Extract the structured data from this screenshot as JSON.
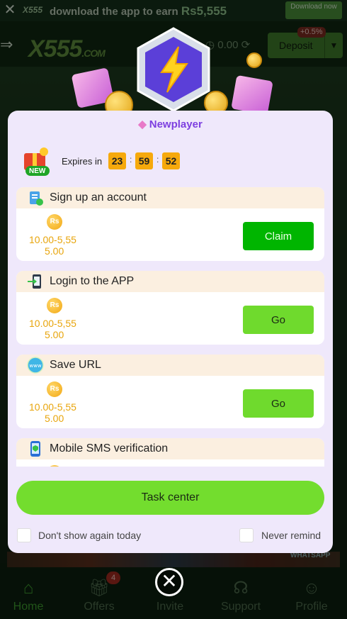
{
  "topbar": {
    "close_glyph": "✕",
    "logo": "X555",
    "promo_text": "download the app to earn",
    "promo_amount": "Rs5,555",
    "download_button": "Download now"
  },
  "header": {
    "logo_main": "X555",
    "logo_suffix": ".COM",
    "balance": "0.00",
    "deposit_label": "Deposit",
    "bonus_badge": "+0.5%"
  },
  "modal": {
    "title": "Newplayer",
    "new_tag": "NEW",
    "expires_label": "Expires in",
    "timer": {
      "hours": "23",
      "minutes": "59",
      "seconds": "52",
      "separator": ":"
    },
    "tasks": [
      {
        "title": "Sign up an account",
        "currency": "Rs",
        "amount_line1": "10.00-5,55",
        "amount_line2": "5.00",
        "button": "Claim",
        "icon": "clipboard-check-icon"
      },
      {
        "title": "Login to the APP",
        "currency": "Rs",
        "amount_line1": "10.00-5,55",
        "amount_line2": "5.00",
        "button": "Go",
        "icon": "phone-login-icon"
      },
      {
        "title": "Save URL",
        "currency": "Rs",
        "amount_line1": "10.00-5,55",
        "amount_line2": "5.00",
        "button": "Go",
        "icon": "www-globe-icon"
      },
      {
        "title": "Mobile SMS verification",
        "currency": "Rs",
        "icon": "mobile-shield-icon"
      }
    ],
    "task_center_button": "Task center",
    "dont_show_label": "Don't show again today",
    "never_remind_label": "Never remind"
  },
  "bottom_nav": {
    "items": [
      {
        "label": "Home",
        "icon": "home-icon"
      },
      {
        "label": "Offers",
        "icon": "gift-icon",
        "badge": "4"
      },
      {
        "label": "Invite",
        "icon": "invite-icon"
      },
      {
        "label": "Support",
        "icon": "headset-icon"
      },
      {
        "label": "Profile",
        "icon": "user-icon"
      }
    ]
  },
  "background_tiles": {
    "whatsapp_label": "WHATSAPP"
  },
  "close_button_glyph": "✕",
  "colors": {
    "accent_purple": "#7d3fe0",
    "claim_green": "#00b500",
    "go_green": "#6fda2d",
    "amount_orange": "#e8a50c",
    "timer_orange": "#f6a90c"
  }
}
